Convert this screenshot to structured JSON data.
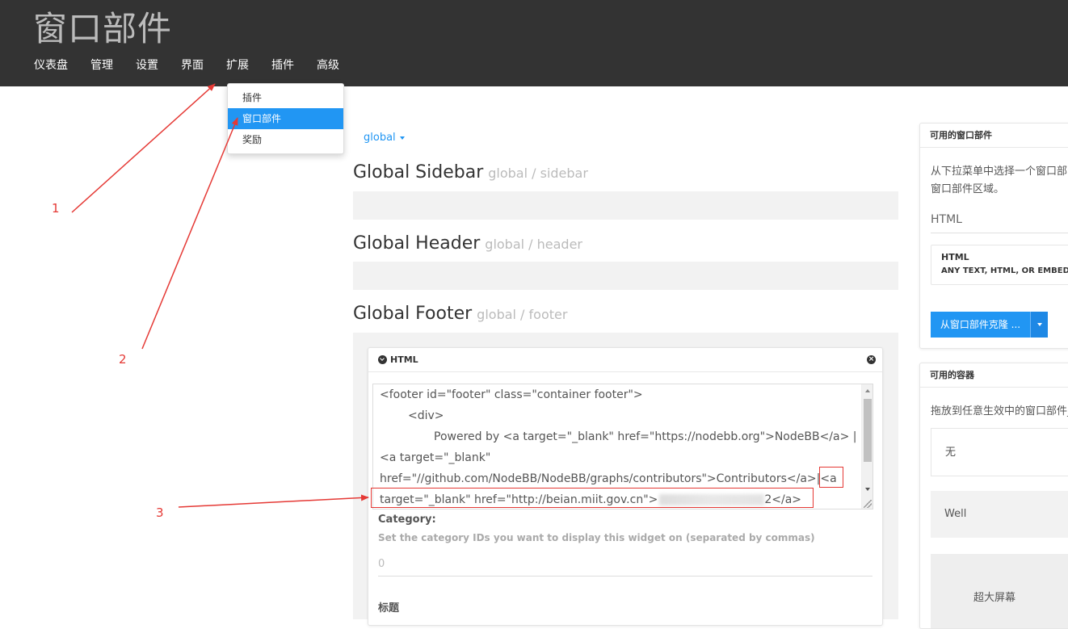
{
  "header": {
    "title": "窗口部件",
    "nav": [
      "仪表盘",
      "管理",
      "设置",
      "界面",
      "扩展",
      "插件",
      "高级"
    ]
  },
  "dropdown": {
    "items": [
      "插件",
      "窗口部件",
      "奖励"
    ],
    "active_item": "窗口部件"
  },
  "template_select": "global",
  "areas": [
    {
      "name": "Global Sidebar",
      "location": "global / sidebar"
    },
    {
      "name": "Global Header",
      "location": "global / header"
    },
    {
      "name": "Global Footer",
      "location": "global / footer"
    }
  ],
  "widget": {
    "title": "HTML",
    "code_lines": [
      "<footer id=\"footer\" class=\"container footer\">",
      "<div>",
      "Powered by <a target=\"_blank\" href=\"https://nodebb.org\">NodeBB</a> |",
      "<a target=\"_blank\"",
      "href=\"//github.com/NodeBB/NodeBB/graphs/contributors\">Contributors</a>",
      "|<a",
      "target=\"_blank\" href=\"http://beian.miit.gov.cn\">",
      "2</a>"
    ],
    "category_label": "Category:",
    "category_help": "Set the category IDs you want to display this widget on (separated by commas)",
    "category_value": "0",
    "title_label": "标题"
  },
  "sidebar": {
    "available_widgets": {
      "heading": "可用的窗口部件",
      "description_line1": "从下拉菜单中选择一个窗口部",
      "description_line2": "窗口部件区域。",
      "select_value": "HTML",
      "tile_title": "HTML",
      "tile_subtitle": "ANY TEXT, HTML, OR EMBED",
      "clone_button": "从窗口部件克隆 ..."
    },
    "available_containers": {
      "heading": "可用的容器",
      "description": "拖放到任意生效中的窗口部件_",
      "containers": [
        "无",
        "Well",
        "超大屏幕"
      ]
    }
  },
  "annotations": {
    "labels": [
      "1",
      "2",
      "3"
    ],
    "color": "#e53935"
  },
  "colors": {
    "header_bg": "#333333",
    "accent": "#2196f3",
    "annotation": "#e53935"
  }
}
